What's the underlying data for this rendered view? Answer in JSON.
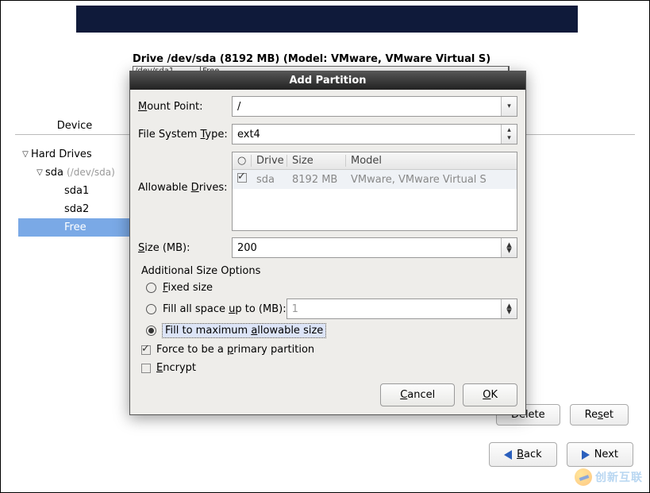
{
  "drive_info": "Drive /dev/sda (8192 MB) (Model: VMware, VMware Virtual S)",
  "drive_map": {
    "seg1": "/dev/sda1",
    "seg2": "Free"
  },
  "device_header": "Device",
  "tree": {
    "root": "Hard Drives",
    "disk": "sda",
    "disk_path": "(/dev/sda)",
    "parts": [
      "sda1",
      "sda2",
      "Free"
    ]
  },
  "buttons": {
    "delete": "Delete",
    "reset": "Reset",
    "back": "Back",
    "next": "Next"
  },
  "dialog": {
    "title": "Add Partition",
    "mount_point_label": "Mount Point:",
    "mount_point_value": "/",
    "fs_type_label": "File System Type:",
    "fs_type_value": "ext4",
    "allowable_label": "Allowable Drives:",
    "drives_head": {
      "drive": "Drive",
      "size": "Size",
      "model": "Model"
    },
    "drive_row": {
      "name": "sda",
      "size": "8192 MB",
      "model": "VMware, VMware Virtual S"
    },
    "size_label": "Size (MB):",
    "size_value": "200",
    "group_title": "Additional Size Options",
    "opt_fixed": "Fixed size",
    "opt_fill_to_pre": "Fill all space ",
    "opt_fill_to_u": "u",
    "opt_fill_to_post": "p to (MB):",
    "opt_fill_to_value": "1",
    "opt_fill_max_pre": "Fill to maximum ",
    "opt_fill_max_u": "a",
    "opt_fill_max_post": "llowable size",
    "force_primary_pre": "Force to be a ",
    "force_primary_u": "p",
    "force_primary_post": "rimary partition",
    "encrypt_u": "E",
    "encrypt_post": "ncrypt",
    "cancel": "Cancel",
    "ok": "OK"
  },
  "watermark": "创新互联"
}
